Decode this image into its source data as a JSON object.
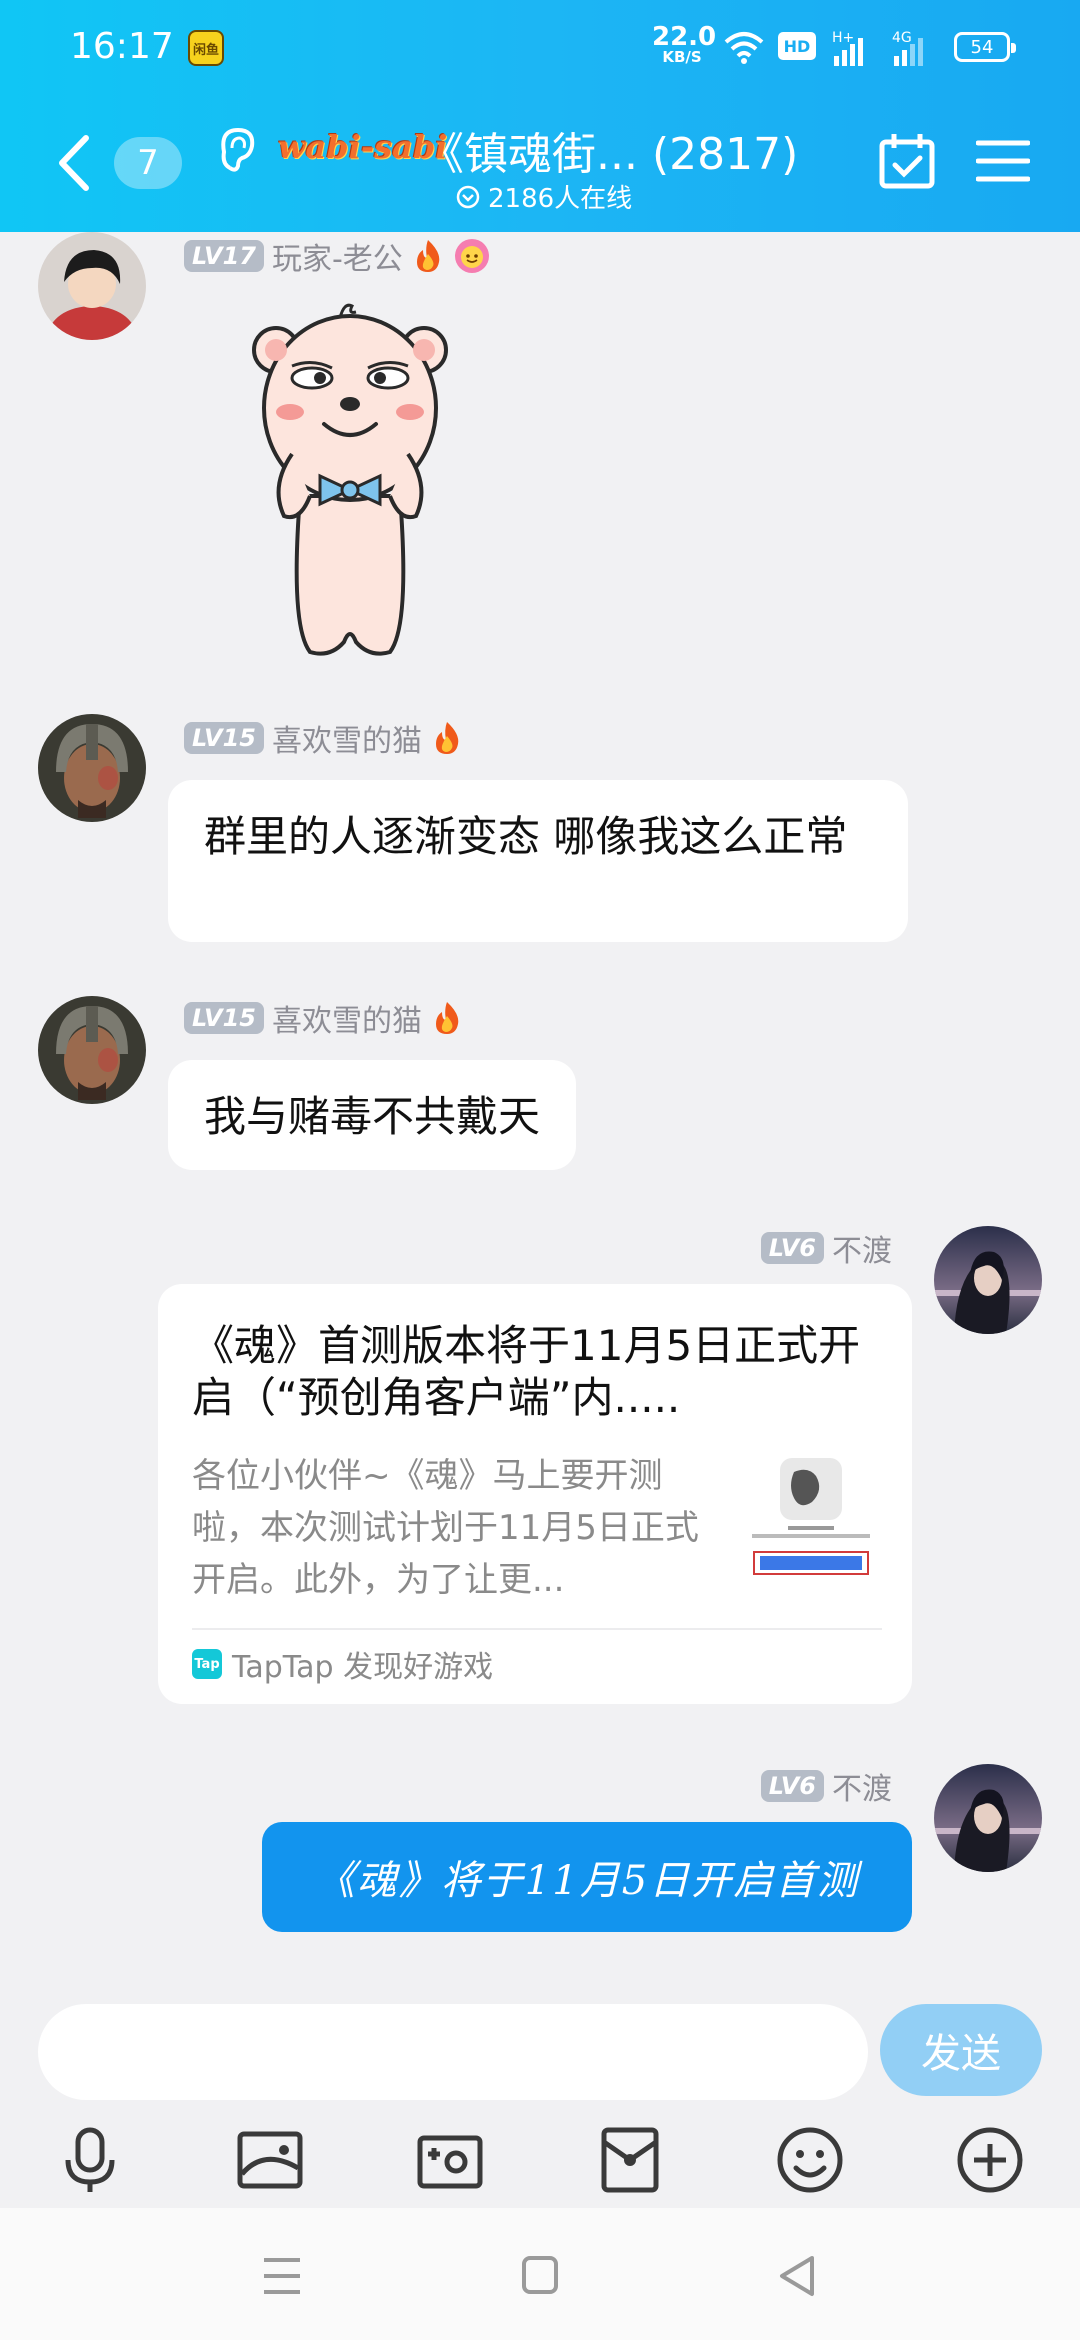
{
  "status_bar": {
    "time": "16:17",
    "notif_app": "闲鱼",
    "net_speed_value": "22.0",
    "net_speed_unit": "KB/S",
    "hd_label": "HD",
    "signal_1": "H+",
    "signal_2": "4G",
    "battery": "54"
  },
  "header": {
    "unread_count": "7",
    "group_logo": "wabi-sabi",
    "group_name": "《镇魂街... (2817)",
    "online_text": "2186人在线"
  },
  "messages": [
    {
      "type": "sticker",
      "level": "LV17",
      "sender": "玩家-老公",
      "side": "left"
    },
    {
      "type": "text",
      "level": "LV15",
      "sender": "喜欢雪的猫",
      "text": "群里的人逐渐变态  哪像我这么正常",
      "side": "left"
    },
    {
      "type": "text",
      "level": "LV15",
      "sender": "喜欢雪的猫",
      "text": "我与赌毒不共戴天",
      "side": "left"
    },
    {
      "type": "card",
      "level": "LV6",
      "sender": "不渡",
      "side": "right",
      "title": "《魂》首测版本将于11月5日正式开启（“预创角客户端”内.....",
      "desc": "各位小伙伴~《魂》马上要开测啦，本次测试计划于11月5日正式开启。此外，为了让更...",
      "source": "TapTap 发现好游戏",
      "source_logo": "Tap"
    },
    {
      "type": "text",
      "level": "LV6",
      "sender": "不渡",
      "text": "《魂》将于11月5日开启首测",
      "side": "right"
    }
  ],
  "input": {
    "placeholder": "",
    "value": "",
    "send_label": "发送"
  },
  "toolbar": [
    "mic-icon",
    "image-icon",
    "camera-icon",
    "red-packet-icon",
    "emoji-icon",
    "plus-icon"
  ],
  "colors": {
    "header": "#18b4f3",
    "send_disabled": "#92cff5",
    "bubble_self": "#1294ee",
    "background": "#f1f1f3"
  }
}
